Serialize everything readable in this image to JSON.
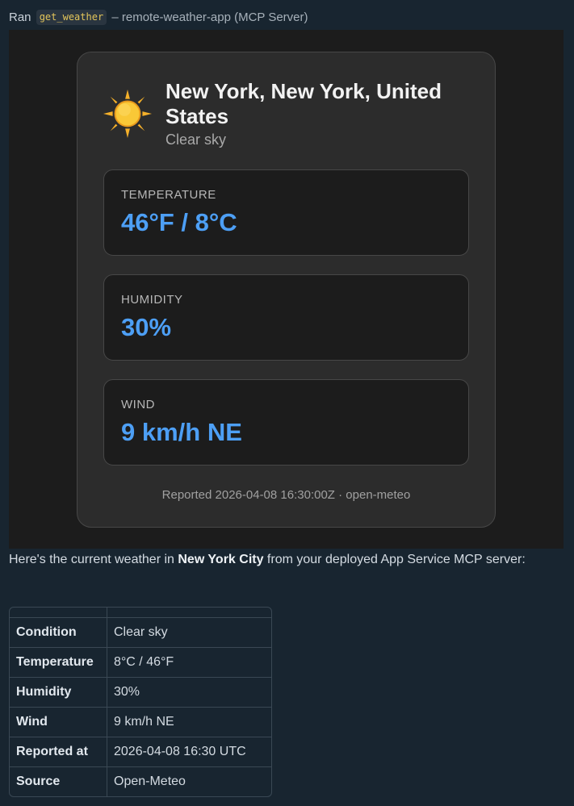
{
  "header": {
    "ran_label": "Ran",
    "tool_name": "get_weather",
    "server_text": "– remote-weather-app (MCP Server)"
  },
  "weather_card": {
    "icon": "sun-icon",
    "location": "New York, New York, United States",
    "condition": "Clear sky",
    "metrics": [
      {
        "label": "TEMPERATURE",
        "value": "46°F / 8°C"
      },
      {
        "label": "HUMIDITY",
        "value": "30%"
      },
      {
        "label": "WIND",
        "value": "9 km/h NE"
      }
    ],
    "reported": "Reported 2026-04-08 16:30:00Z · open-meteo"
  },
  "summary": {
    "before": "Here's the current weather in ",
    "city": "New York City",
    "after": " from your deployed App Service MCP server:"
  },
  "table": {
    "rows": [
      {
        "key": "Condition",
        "value": "Clear sky"
      },
      {
        "key": "Temperature",
        "value": "8°C / 46°F"
      },
      {
        "key": "Humidity",
        "value": "30%"
      },
      {
        "key": "Wind",
        "value": "9 km/h NE"
      },
      {
        "key": "Reported at",
        "value": "2026-04-08 16:30 UTC"
      },
      {
        "key": "Source",
        "value": "Open-Meteo"
      }
    ]
  },
  "colors": {
    "page_background": "#182530",
    "card_background": "#2c2c2c",
    "metric_value": "#4d9ff5",
    "tool_name": "#e3c55a"
  }
}
